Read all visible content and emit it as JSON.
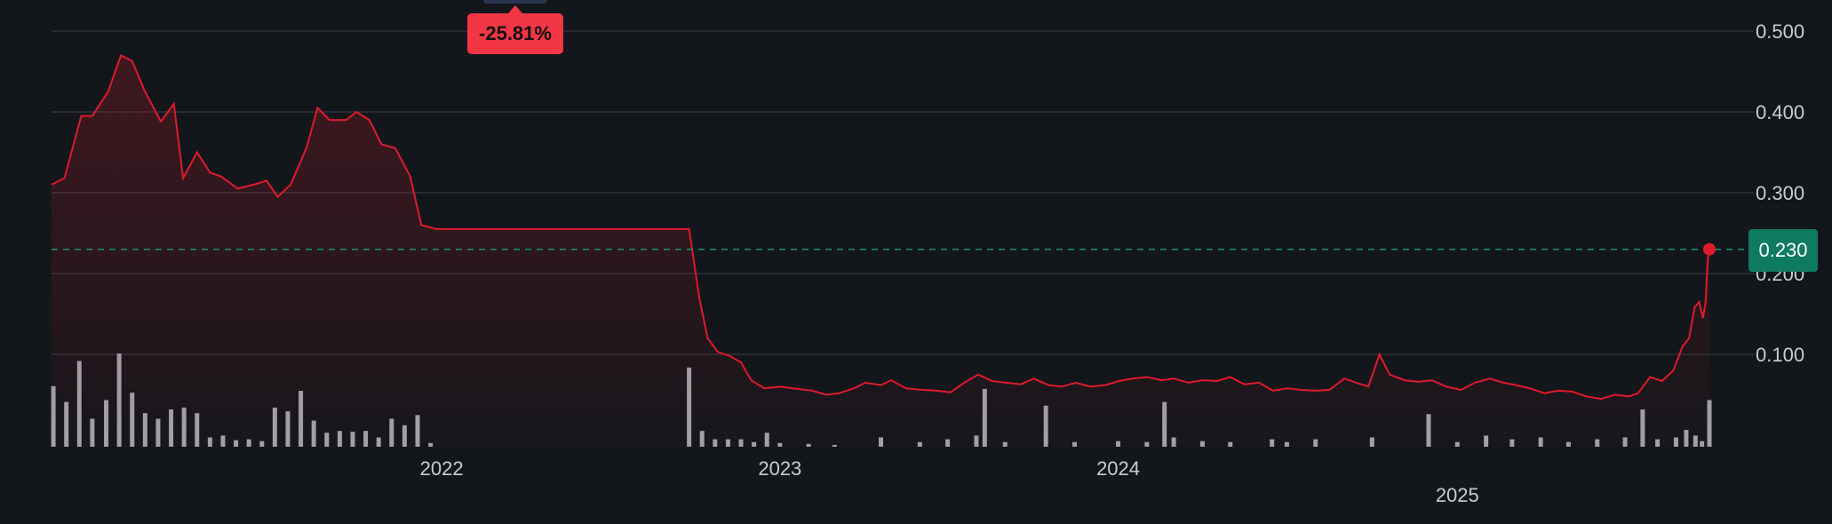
{
  "change_badge": {
    "text": "-25.81%",
    "color": "#f23645"
  },
  "current_price": {
    "label": "0.230",
    "value": 0.23,
    "color": "#0e7a62"
  },
  "colors": {
    "line": "#e0192d",
    "volume": "#9ea3a8",
    "grid": "#3b4046",
    "reference_line": "#1f8f70",
    "background": "#13171b"
  },
  "chart_data": {
    "type": "line",
    "title": "",
    "xlabel": "",
    "ylabel": "",
    "ylim": [
      0,
      0.5
    ],
    "grid": true,
    "y_ticks": [
      "0.100",
      "0.200",
      "0.300",
      "0.400",
      "0.500"
    ],
    "x_ticks": [
      {
        "label": "2022",
        "date": "2022-01-01"
      },
      {
        "label": "2023",
        "date": "2023-01-01"
      },
      {
        "label": "2024",
        "date": "2024-01-01"
      },
      {
        "label": "2025",
        "date": "2025-01-01"
      }
    ],
    "x_range": [
      "2020-11-06",
      "2025-09-30"
    ],
    "reference_line": 0.23,
    "series": [
      {
        "type": "line",
        "points": [
          [
            "2020-11-06",
            0.31
          ],
          [
            "2020-11-20",
            0.318
          ],
          [
            "2020-12-08",
            0.395
          ],
          [
            "2020-12-20",
            0.395
          ],
          [
            "2021-01-06",
            0.425
          ],
          [
            "2021-01-20",
            0.47
          ],
          [
            "2021-02-01",
            0.463
          ],
          [
            "2021-02-15",
            0.425
          ],
          [
            "2021-03-04",
            0.388
          ],
          [
            "2021-03-18",
            0.41
          ],
          [
            "2021-03-28",
            0.318
          ],
          [
            "2021-04-12",
            0.35
          ],
          [
            "2021-04-26",
            0.325
          ],
          [
            "2021-05-08",
            0.32
          ],
          [
            "2021-05-26",
            0.305
          ],
          [
            "2021-06-12",
            0.31
          ],
          [
            "2021-06-26",
            0.315
          ],
          [
            "2021-07-08",
            0.295
          ],
          [
            "2021-07-22",
            0.31
          ],
          [
            "2021-08-08",
            0.355
          ],
          [
            "2021-08-20",
            0.405
          ],
          [
            "2021-09-02",
            0.39
          ],
          [
            "2021-09-20",
            0.39
          ],
          [
            "2021-10-01",
            0.4
          ],
          [
            "2021-10-15",
            0.39
          ],
          [
            "2021-10-28",
            0.36
          ],
          [
            "2021-11-12",
            0.355
          ],
          [
            "2021-11-28",
            0.32
          ],
          [
            "2021-12-10",
            0.26
          ],
          [
            "2021-12-26",
            0.255
          ],
          [
            "2022-01-15",
            0.255
          ],
          [
            "2022-06-01",
            0.255
          ],
          [
            "2022-09-01",
            0.255
          ],
          [
            "2022-09-25",
            0.255
          ],
          [
            "2022-10-06",
            0.17
          ],
          [
            "2022-10-15",
            0.12
          ],
          [
            "2022-10-26",
            0.103
          ],
          [
            "2022-11-08",
            0.098
          ],
          [
            "2022-11-20",
            0.09
          ],
          [
            "2022-12-01",
            0.068
          ],
          [
            "2022-12-15",
            0.058
          ],
          [
            "2023-01-01",
            0.06
          ],
          [
            "2023-01-15",
            0.058
          ],
          [
            "2023-02-05",
            0.055
          ],
          [
            "2023-02-20",
            0.05
          ],
          [
            "2023-03-06",
            0.052
          ],
          [
            "2023-03-22",
            0.058
          ],
          [
            "2023-04-03",
            0.065
          ],
          [
            "2023-04-20",
            0.062
          ],
          [
            "2023-05-01",
            0.068
          ],
          [
            "2023-05-17",
            0.058
          ],
          [
            "2023-06-04",
            0.056
          ],
          [
            "2023-06-20",
            0.055
          ],
          [
            "2023-07-04",
            0.053
          ],
          [
            "2023-07-19",
            0.065
          ],
          [
            "2023-08-03",
            0.075
          ],
          [
            "2023-08-18",
            0.067
          ],
          [
            "2023-09-02",
            0.065
          ],
          [
            "2023-09-18",
            0.063
          ],
          [
            "2023-10-02",
            0.07
          ],
          [
            "2023-10-18",
            0.062
          ],
          [
            "2023-11-01",
            0.06
          ],
          [
            "2023-11-16",
            0.065
          ],
          [
            "2023-12-02",
            0.06
          ],
          [
            "2023-12-18",
            0.062
          ],
          [
            "2024-01-02",
            0.067
          ],
          [
            "2024-01-17",
            0.07
          ],
          [
            "2024-02-01",
            0.072
          ],
          [
            "2024-02-17",
            0.068
          ],
          [
            "2024-03-01",
            0.07
          ],
          [
            "2024-03-17",
            0.065
          ],
          [
            "2024-04-01",
            0.068
          ],
          [
            "2024-04-17",
            0.067
          ],
          [
            "2024-05-01",
            0.072
          ],
          [
            "2024-05-16",
            0.063
          ],
          [
            "2024-06-01",
            0.065
          ],
          [
            "2024-06-16",
            0.055
          ],
          [
            "2024-07-01",
            0.058
          ],
          [
            "2024-07-16",
            0.056
          ],
          [
            "2024-08-01",
            0.055
          ],
          [
            "2024-08-16",
            0.056
          ],
          [
            "2024-09-01",
            0.07
          ],
          [
            "2024-09-14",
            0.065
          ],
          [
            "2024-09-27",
            0.06
          ],
          [
            "2024-10-09",
            0.1
          ],
          [
            "2024-10-20",
            0.075
          ],
          [
            "2024-11-05",
            0.068
          ],
          [
            "2024-11-20",
            0.066
          ],
          [
            "2024-12-05",
            0.068
          ],
          [
            "2024-12-20",
            0.06
          ],
          [
            "2025-01-05",
            0.056
          ],
          [
            "2025-01-20",
            0.065
          ],
          [
            "2025-02-05",
            0.07
          ],
          [
            "2025-02-20",
            0.065
          ],
          [
            "2025-03-05",
            0.062
          ],
          [
            "2025-03-20",
            0.058
          ],
          [
            "2025-04-05",
            0.052
          ],
          [
            "2025-04-20",
            0.055
          ],
          [
            "2025-05-05",
            0.054
          ],
          [
            "2025-05-20",
            0.048
          ],
          [
            "2025-06-05",
            0.045
          ],
          [
            "2025-06-20",
            0.05
          ],
          [
            "2025-07-05",
            0.048
          ],
          [
            "2025-07-15",
            0.052
          ],
          [
            "2025-07-28",
            0.072
          ],
          [
            "2025-08-10",
            0.067
          ],
          [
            "2025-08-22",
            0.08
          ],
          [
            "2025-09-01",
            0.11
          ],
          [
            "2025-09-08",
            0.12
          ],
          [
            "2025-09-14",
            0.158
          ],
          [
            "2025-09-19",
            0.165
          ],
          [
            "2025-09-23",
            0.145
          ],
          [
            "2025-09-26",
            0.165
          ],
          [
            "2025-09-28",
            0.215
          ],
          [
            "2025-09-30",
            0.23
          ]
        ]
      },
      {
        "type": "volume_bars",
        "scale": "relative (tallest bar = 1.0)",
        "bars": [
          [
            "2020-11-08",
            0.65
          ],
          [
            "2020-11-22",
            0.48
          ],
          [
            "2020-12-06",
            0.92
          ],
          [
            "2020-12-20",
            0.3
          ],
          [
            "2021-01-04",
            0.5
          ],
          [
            "2021-01-18",
            1.0
          ],
          [
            "2021-02-01",
            0.58
          ],
          [
            "2021-02-15",
            0.36
          ],
          [
            "2021-03-01",
            0.3
          ],
          [
            "2021-03-15",
            0.4
          ],
          [
            "2021-03-29",
            0.42
          ],
          [
            "2021-04-12",
            0.36
          ],
          [
            "2021-04-26",
            0.1
          ],
          [
            "2021-05-10",
            0.12
          ],
          [
            "2021-05-24",
            0.07
          ],
          [
            "2021-06-07",
            0.08
          ],
          [
            "2021-06-21",
            0.06
          ],
          [
            "2021-07-05",
            0.42
          ],
          [
            "2021-07-19",
            0.38
          ],
          [
            "2021-08-02",
            0.6
          ],
          [
            "2021-08-16",
            0.28
          ],
          [
            "2021-08-30",
            0.15
          ],
          [
            "2021-09-13",
            0.17
          ],
          [
            "2021-09-27",
            0.16
          ],
          [
            "2021-10-11",
            0.17
          ],
          [
            "2021-10-25",
            0.1
          ],
          [
            "2021-11-08",
            0.3
          ],
          [
            "2021-11-22",
            0.23
          ],
          [
            "2021-12-06",
            0.34
          ],
          [
            "2021-12-20",
            0.04
          ],
          [
            "2022-09-25",
            0.85
          ],
          [
            "2022-10-09",
            0.17
          ],
          [
            "2022-10-23",
            0.08
          ],
          [
            "2022-11-06",
            0.08
          ],
          [
            "2022-11-20",
            0.08
          ],
          [
            "2022-12-04",
            0.05
          ],
          [
            "2022-12-18",
            0.15
          ],
          [
            "2023-01-01",
            0.04
          ],
          [
            "2023-02-01",
            0.03
          ],
          [
            "2023-03-01",
            0.02
          ],
          [
            "2023-04-20",
            0.1
          ],
          [
            "2023-06-01",
            0.05
          ],
          [
            "2023-07-01",
            0.08
          ],
          [
            "2023-08-01",
            0.12
          ],
          [
            "2023-08-10",
            0.62
          ],
          [
            "2023-09-01",
            0.05
          ],
          [
            "2023-10-15",
            0.44
          ],
          [
            "2023-11-15",
            0.05
          ],
          [
            "2024-01-01",
            0.06
          ],
          [
            "2024-02-01",
            0.05
          ],
          [
            "2024-02-20",
            0.48
          ],
          [
            "2024-03-01",
            0.1
          ],
          [
            "2024-04-01",
            0.06
          ],
          [
            "2024-05-01",
            0.05
          ],
          [
            "2024-06-15",
            0.08
          ],
          [
            "2024-07-01",
            0.05
          ],
          [
            "2024-08-01",
            0.08
          ],
          [
            "2024-10-01",
            0.1
          ],
          [
            "2024-12-01",
            0.35
          ],
          [
            "2025-01-01",
            0.05
          ],
          [
            "2025-02-01",
            0.12
          ],
          [
            "2025-03-01",
            0.08
          ],
          [
            "2025-04-01",
            0.1
          ],
          [
            "2025-05-01",
            0.05
          ],
          [
            "2025-06-01",
            0.08
          ],
          [
            "2025-07-01",
            0.1
          ],
          [
            "2025-07-20",
            0.4
          ],
          [
            "2025-08-05",
            0.08
          ],
          [
            "2025-08-25",
            0.1
          ],
          [
            "2025-09-05",
            0.18
          ],
          [
            "2025-09-15",
            0.12
          ],
          [
            "2025-09-22",
            0.06
          ],
          [
            "2025-09-30",
            0.5
          ]
        ]
      }
    ]
  }
}
